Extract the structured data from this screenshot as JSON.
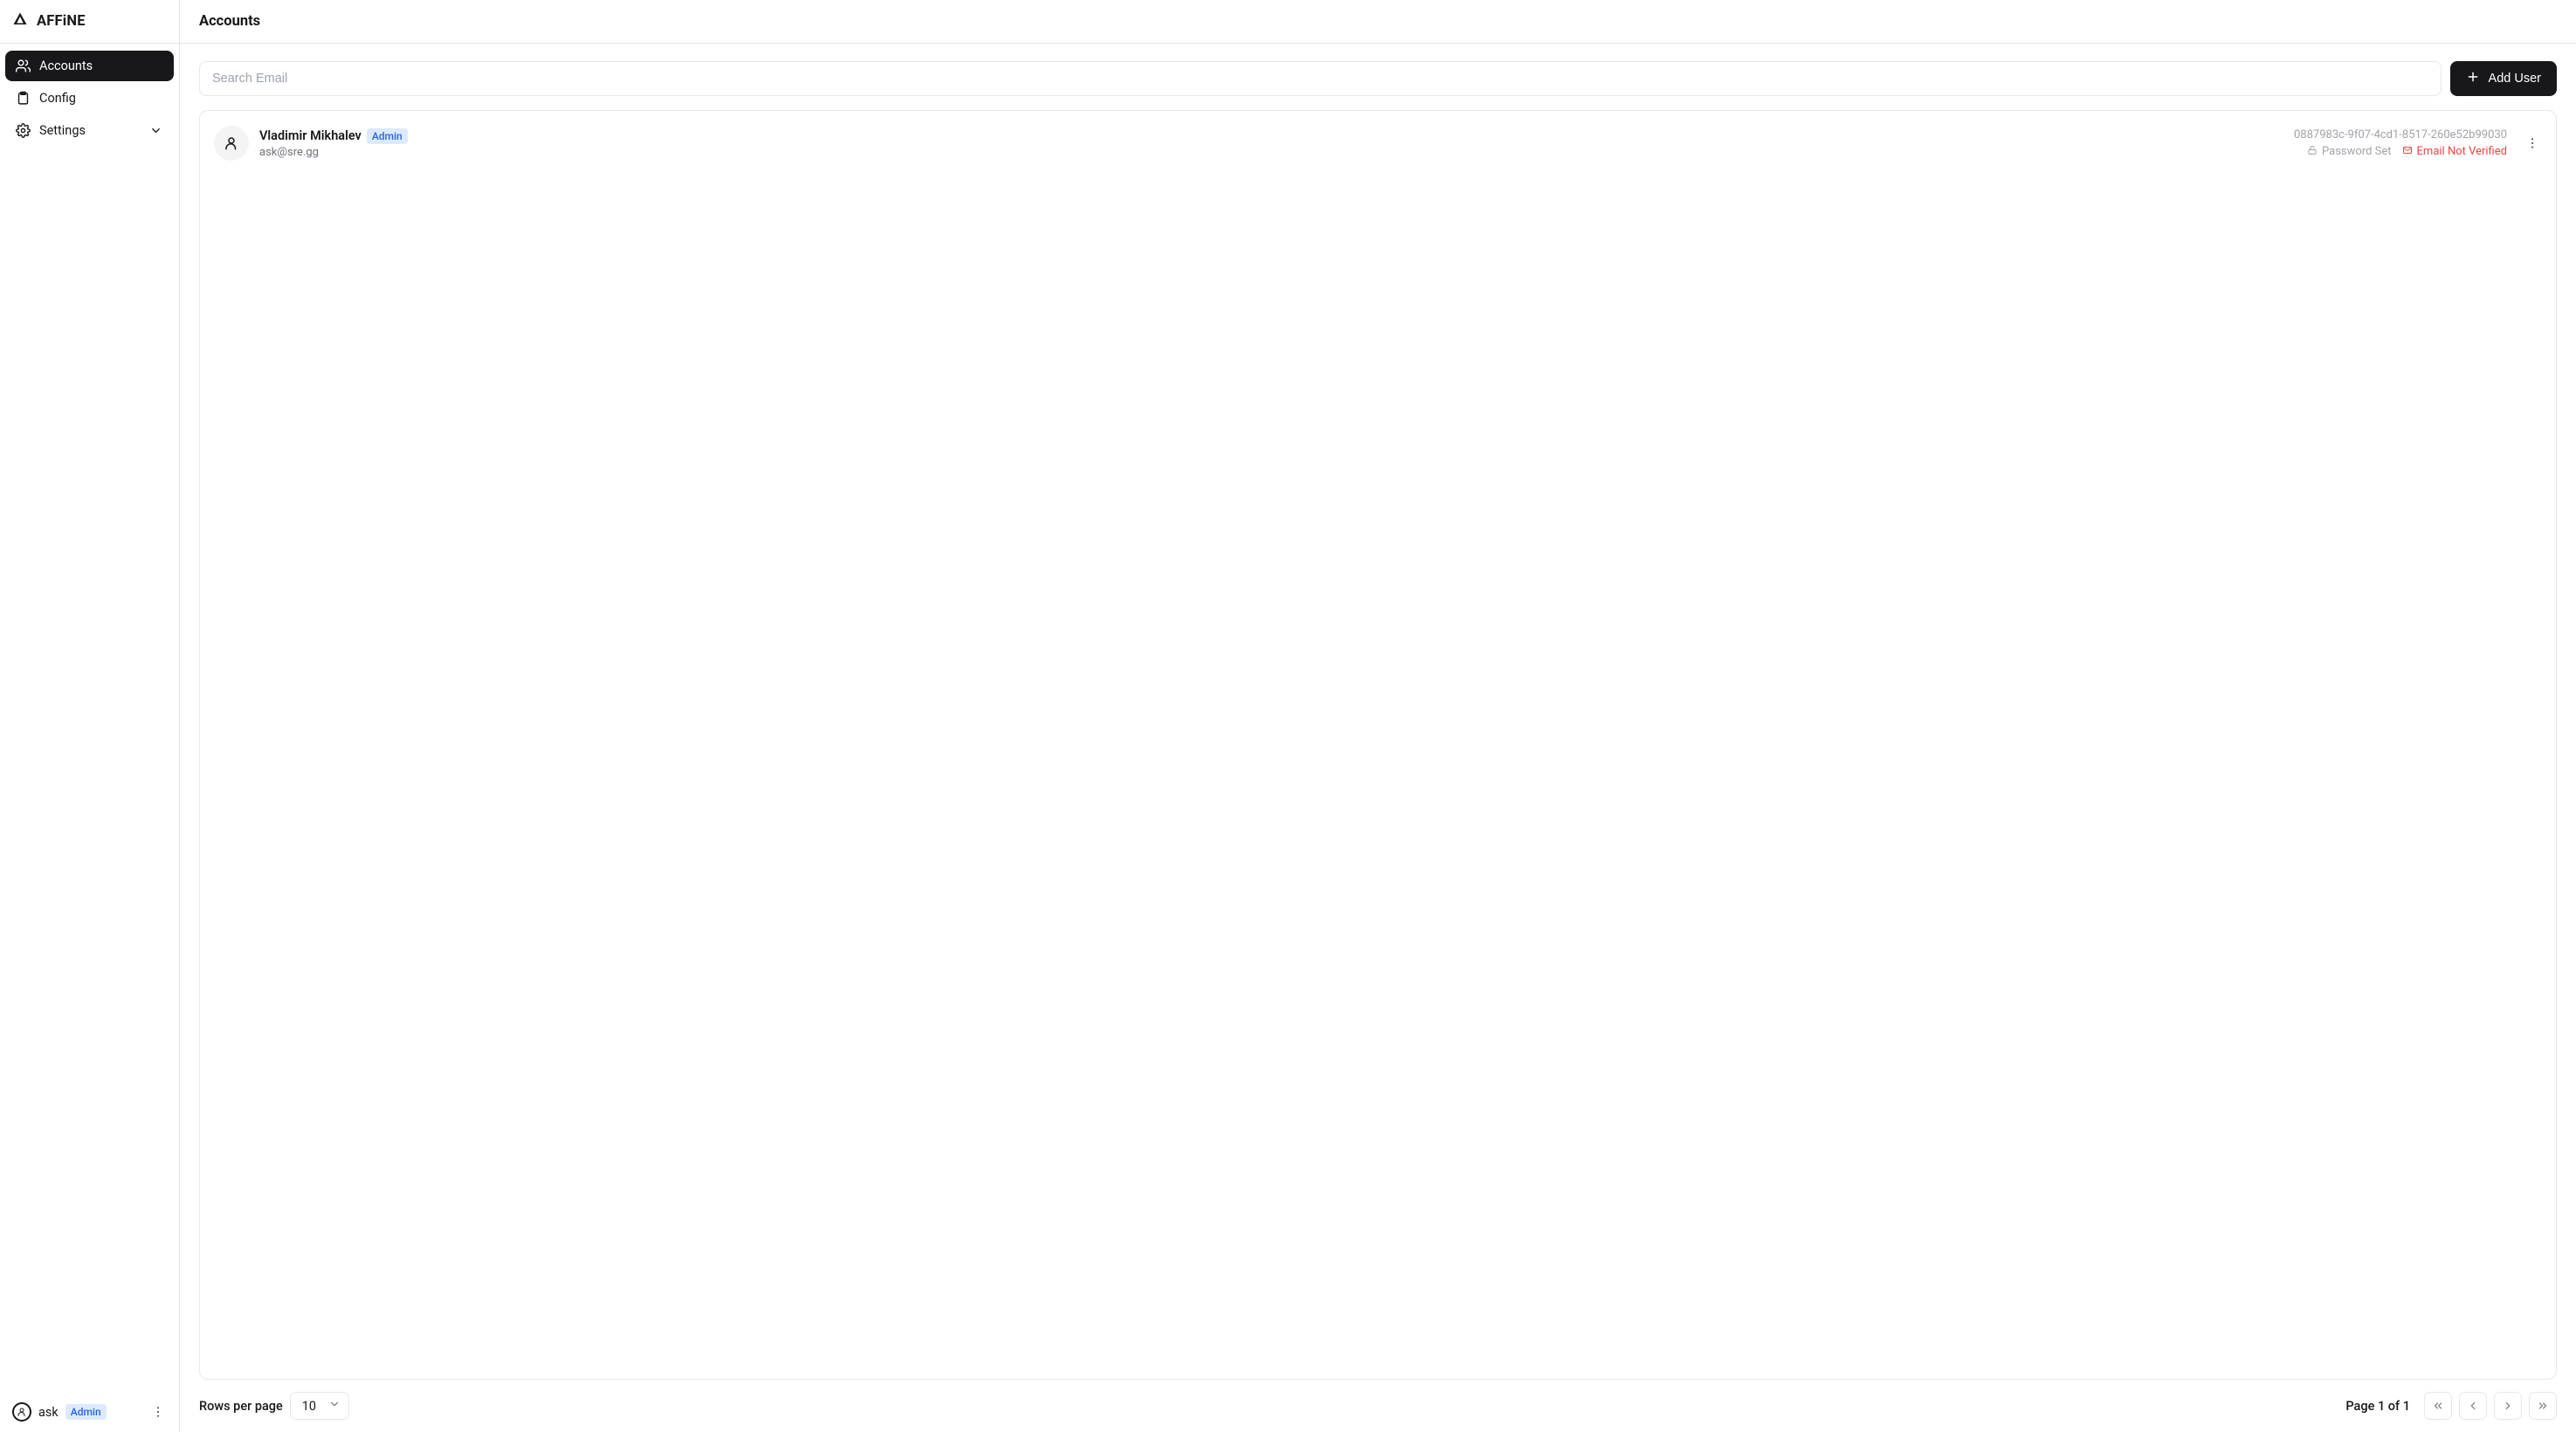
{
  "brand": "AFFiNE",
  "header": {
    "title": "Accounts"
  },
  "sidebar": {
    "items": [
      {
        "label": "Accounts"
      },
      {
        "label": "Config"
      },
      {
        "label": "Settings"
      }
    ],
    "footer_user": "ask",
    "footer_badge": "Admin"
  },
  "toolbar": {
    "search_placeholder": "Search Email",
    "add_user_label": "Add User"
  },
  "users": [
    {
      "name": "Vladimir Mikhalev",
      "badge": "Admin",
      "email": "ask@sre.gg",
      "id": "0887983c-9f07-4cd1-8517-260e52b99030",
      "password_status": "Password Set",
      "email_status": "Email Not Verified"
    }
  ],
  "footer": {
    "rows_label": "Rows per page",
    "rows_value": "10",
    "page_text": "Page 1 of 1"
  }
}
